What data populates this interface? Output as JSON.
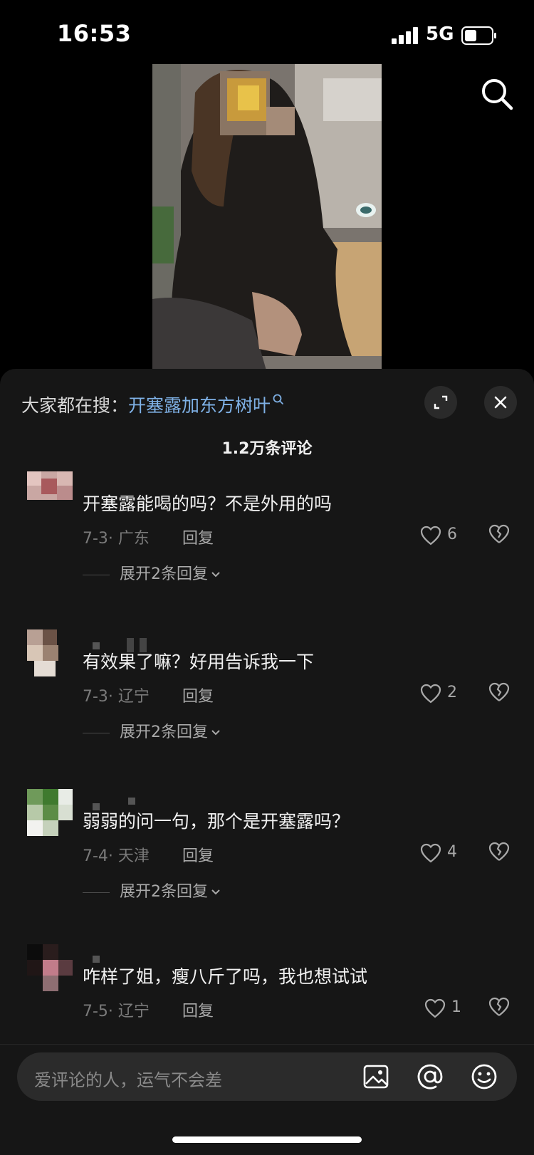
{
  "status_bar": {
    "time": "16:53",
    "network": "5G",
    "battery_level": 0.4
  },
  "video": {
    "has_search_icon": "search-icon"
  },
  "sheet": {
    "search_prefix": "大家都在搜：",
    "search_keyword": "开塞露加东方树叶",
    "comment_count": "1.2万条评论",
    "icons": [
      "expand-icon",
      "close-icon"
    ]
  },
  "comments": [
    {
      "text": "开塞露能喝的吗？不是外用的吗",
      "meta": "7-3· 广东",
      "reply": "回复",
      "likes": "6",
      "expand": "展开2条回复"
    },
    {
      "text": "有效果了嘛？好用告诉我一下",
      "meta": "7-3· 辽宁",
      "reply": "回复",
      "likes": "2",
      "expand": "展开2条回复"
    },
    {
      "text": "弱弱的问一句，那个是开塞露吗？",
      "meta": "7-4· 天津",
      "reply": "回复",
      "likes": "4",
      "expand": "展开2条回复"
    },
    {
      "text": "咋样了姐，瘦八斤了吗，我也想试试",
      "meta": "7-5· 辽宁",
      "reply": "回复",
      "likes": "1"
    }
  ],
  "input_bar": {
    "placeholder": "爱评论的人，运气不会差",
    "icons": [
      "image-icon",
      "at-icon",
      "emoji-icon"
    ]
  },
  "colors": {
    "sheet_bg": "#161616",
    "keyword": "#7fb1e6",
    "meta": "#7a7a7a"
  }
}
